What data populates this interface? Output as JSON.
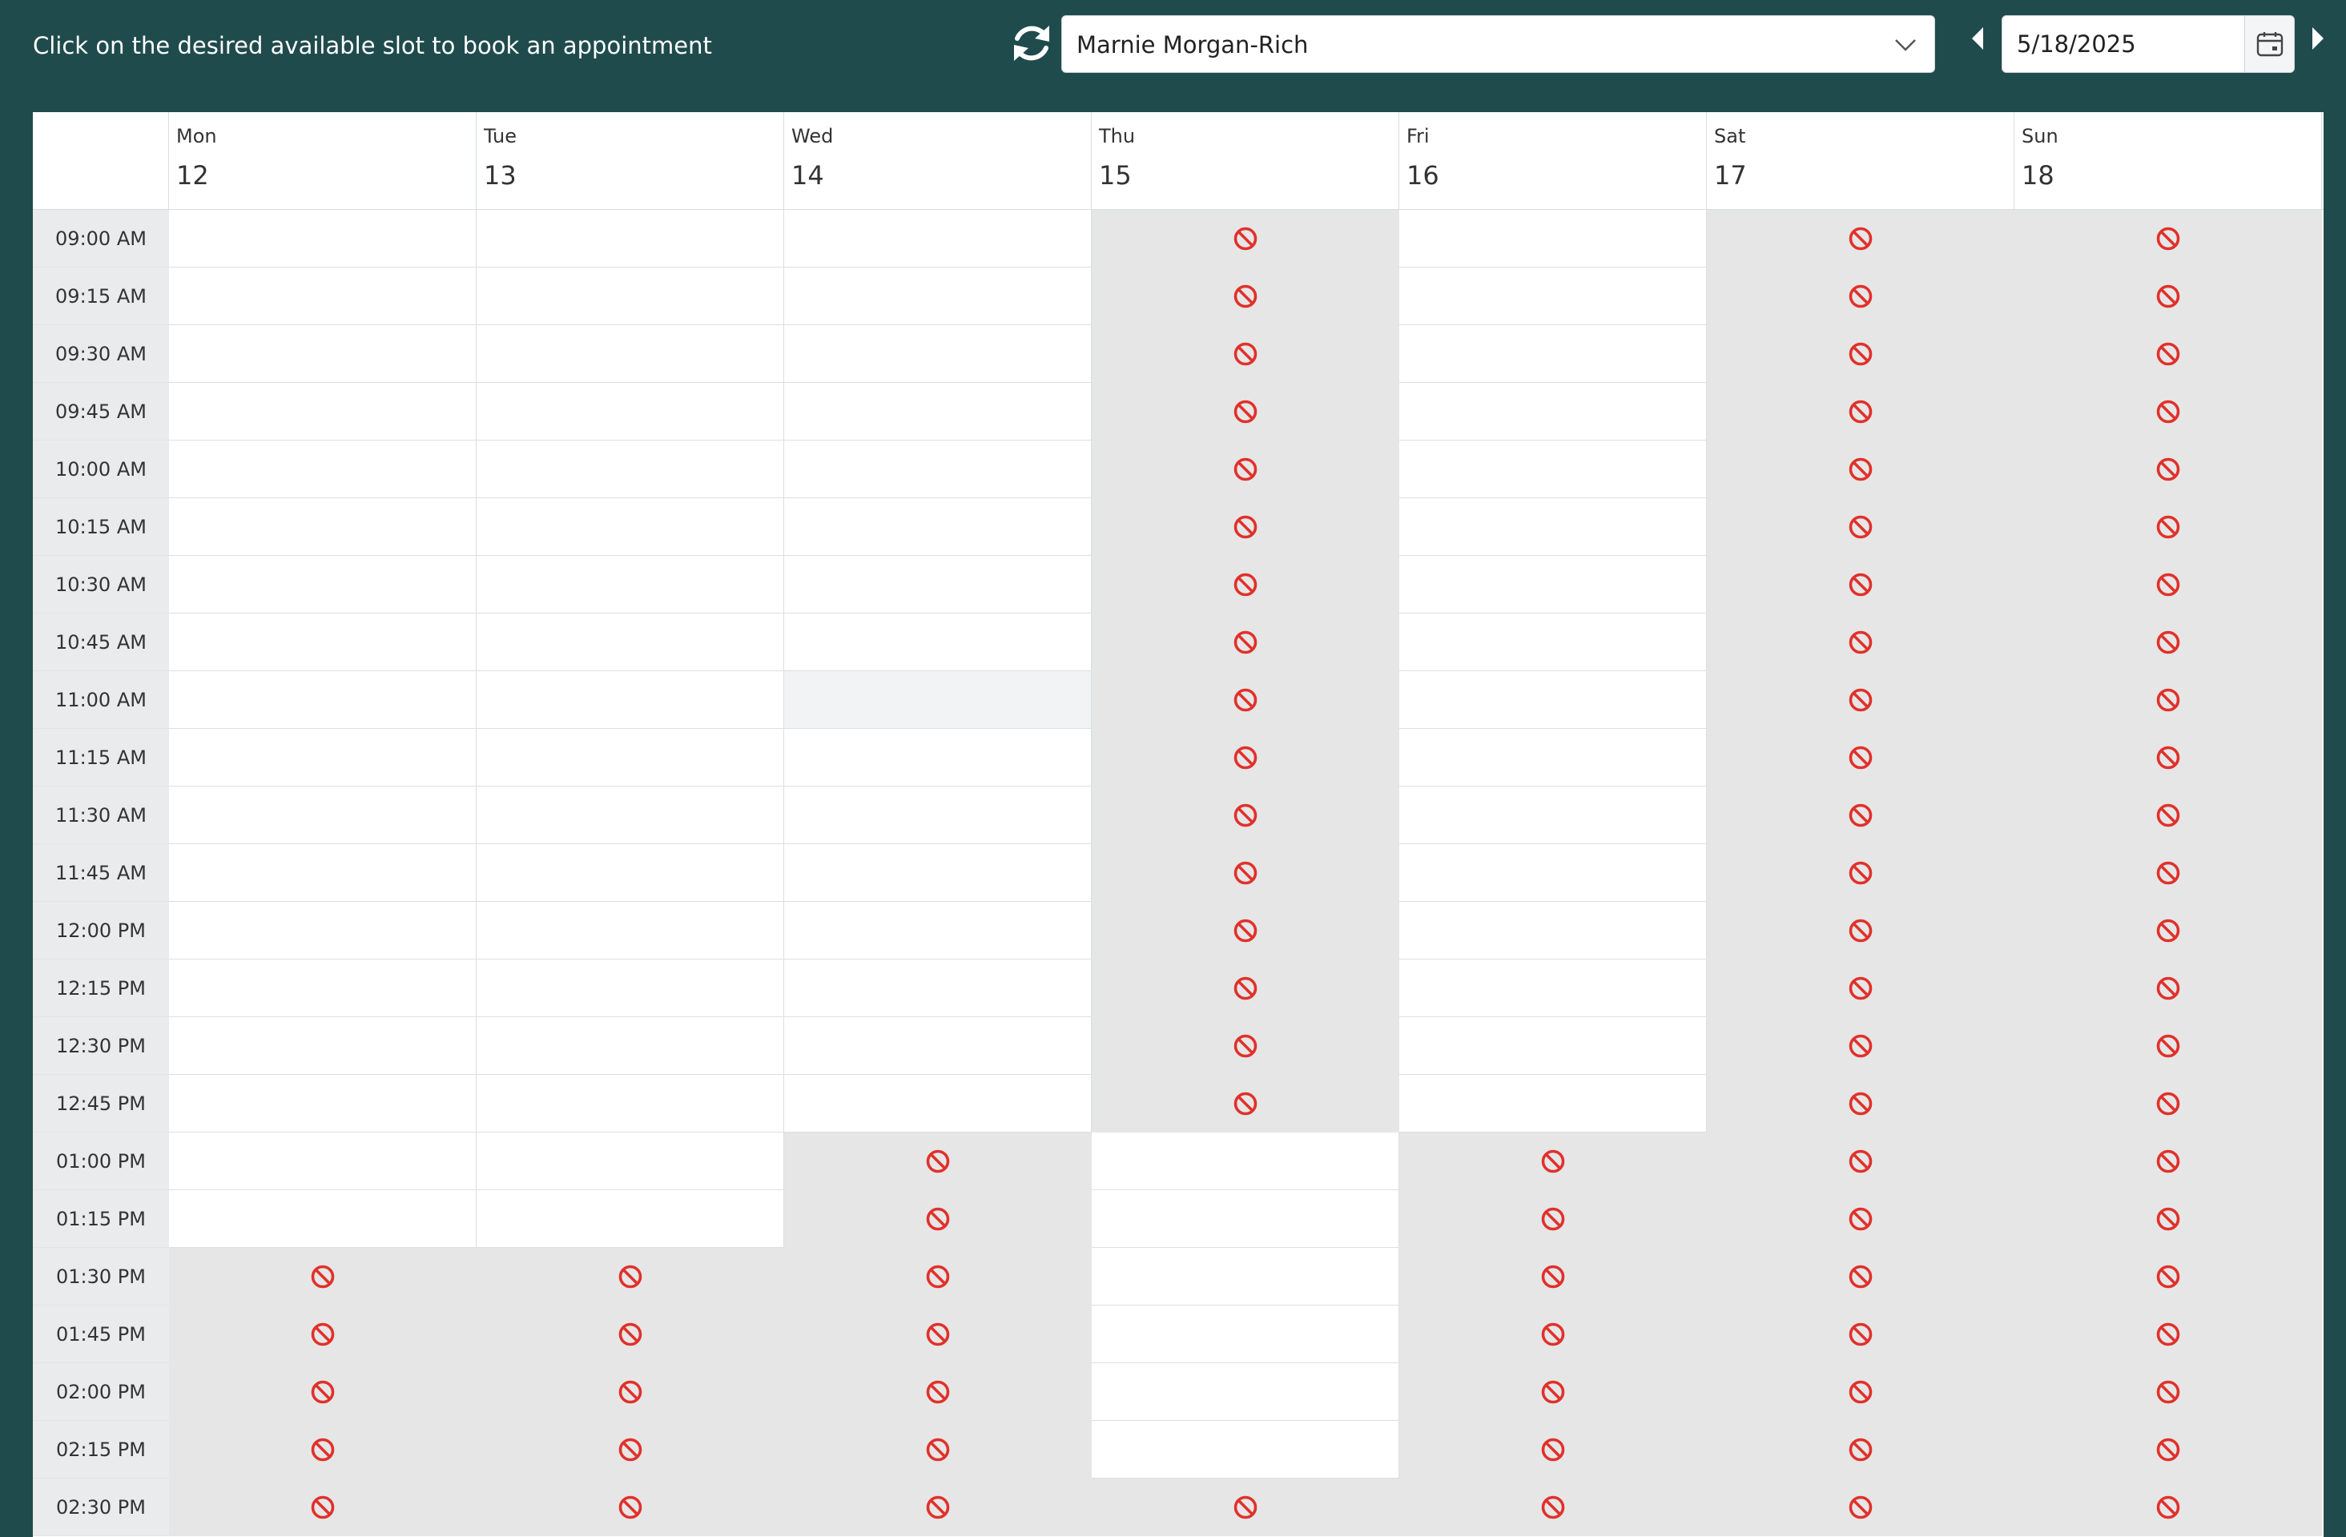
{
  "header": {
    "instruction": "Click on the desired available slot to book an appointment",
    "provider": "Marnie Morgan-Rich",
    "date": "5/18/2025"
  },
  "icons": {
    "refresh": "refresh-icon",
    "dropdown": "chevron-down-icon",
    "prev": "caret-left-icon",
    "next": "caret-right-icon",
    "calendar": "calendar-icon",
    "blocked": "prohibited-icon"
  },
  "colors": {
    "background": "#204b4c",
    "blocked_slot": "#e6e6e6",
    "prohibited_icon": "#e0312b",
    "time_column": "#e9ebec"
  },
  "days": [
    {
      "name": "Mon",
      "num": "12"
    },
    {
      "name": "Tue",
      "num": "13"
    },
    {
      "name": "Wed",
      "num": "14"
    },
    {
      "name": "Thu",
      "num": "15"
    },
    {
      "name": "Fri",
      "num": "16"
    },
    {
      "name": "Sat",
      "num": "17"
    },
    {
      "name": "Sun",
      "num": "18"
    }
  ],
  "times": [
    "09:00 AM",
    "09:15 AM",
    "09:30 AM",
    "09:45 AM",
    "10:00 AM",
    "10:15 AM",
    "10:30 AM",
    "10:45 AM",
    "11:00 AM",
    "11:15 AM",
    "11:30 AM",
    "11:45 AM",
    "12:00 PM",
    "12:15 PM",
    "12:30 PM",
    "12:45 PM",
    "01:00 PM",
    "01:15 PM",
    "01:30 PM",
    "01:45 PM",
    "02:00 PM",
    "02:15 PM",
    "02:30 PM"
  ],
  "grid": [
    [
      "open",
      "open",
      "open",
      "blocked",
      "open",
      "blocked",
      "blocked"
    ],
    [
      "open",
      "open",
      "open",
      "blocked",
      "open",
      "blocked",
      "blocked"
    ],
    [
      "open",
      "open",
      "open",
      "blocked",
      "open",
      "blocked",
      "blocked"
    ],
    [
      "open",
      "open",
      "open",
      "blocked",
      "open",
      "blocked",
      "blocked"
    ],
    [
      "open",
      "open",
      "open",
      "blocked",
      "open",
      "blocked",
      "blocked"
    ],
    [
      "open",
      "open",
      "open",
      "blocked",
      "open",
      "blocked",
      "blocked"
    ],
    [
      "open",
      "open",
      "open",
      "blocked",
      "open",
      "blocked",
      "blocked"
    ],
    [
      "open",
      "open",
      "open",
      "blocked",
      "open",
      "blocked",
      "blocked"
    ],
    [
      "open",
      "open",
      "hover",
      "blocked",
      "open",
      "blocked",
      "blocked"
    ],
    [
      "open",
      "open",
      "open",
      "blocked",
      "open",
      "blocked",
      "blocked"
    ],
    [
      "open",
      "open",
      "open",
      "blocked",
      "open",
      "blocked",
      "blocked"
    ],
    [
      "open",
      "open",
      "open",
      "blocked",
      "open",
      "blocked",
      "blocked"
    ],
    [
      "open",
      "open",
      "open",
      "blocked",
      "open",
      "blocked",
      "blocked"
    ],
    [
      "open",
      "open",
      "open",
      "blocked",
      "open",
      "blocked",
      "blocked"
    ],
    [
      "open",
      "open",
      "open",
      "blocked",
      "open",
      "blocked",
      "blocked"
    ],
    [
      "open",
      "open",
      "open",
      "blocked",
      "open",
      "blocked",
      "blocked"
    ],
    [
      "open",
      "open",
      "blocked",
      "open",
      "blocked",
      "blocked",
      "blocked"
    ],
    [
      "open",
      "open",
      "blocked",
      "open",
      "blocked",
      "blocked",
      "blocked"
    ],
    [
      "blocked",
      "blocked",
      "blocked",
      "open",
      "blocked",
      "blocked",
      "blocked"
    ],
    [
      "blocked",
      "blocked",
      "blocked",
      "open",
      "blocked",
      "blocked",
      "blocked"
    ],
    [
      "blocked",
      "blocked",
      "blocked",
      "open",
      "blocked",
      "blocked",
      "blocked"
    ],
    [
      "blocked",
      "blocked",
      "blocked",
      "open",
      "blocked",
      "blocked",
      "blocked"
    ],
    [
      "blocked",
      "blocked",
      "blocked",
      "blocked",
      "blocked",
      "blocked",
      "blocked"
    ]
  ]
}
